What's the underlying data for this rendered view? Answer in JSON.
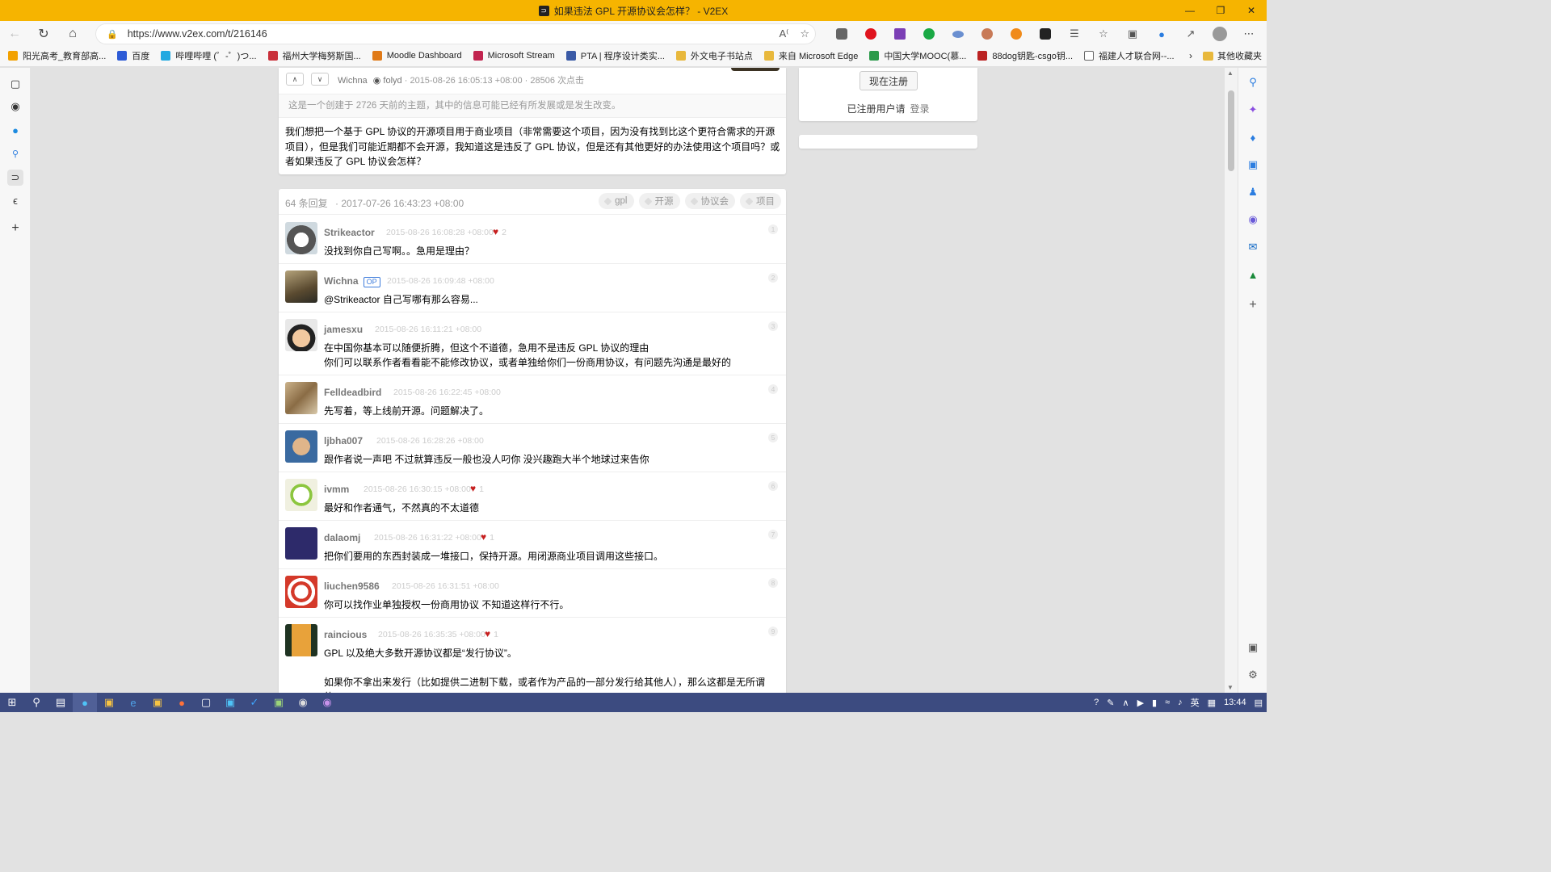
{
  "window": {
    "title": "如果违法 GPL 开源协议会怎样？ - V2EX"
  },
  "toolbar": {
    "url": "https://www.v2ex.com/t/216146"
  },
  "bookmarks": [
    {
      "label": "阳光高考_教育部高...",
      "color": "#f2a100"
    },
    {
      "label": "百度",
      "color": "#2d5bd6"
    },
    {
      "label": "哔哩哔哩 (゜-゜)つ...",
      "color": "#22a9e1"
    },
    {
      "label": "福州大学梅努斯国...",
      "color": "#c9303a"
    },
    {
      "label": "Moodle Dashboard",
      "color": "#e07a17"
    },
    {
      "label": "Microsoft Stream",
      "color": "#c1244f"
    },
    {
      "label": "PTA | 程序设计类实...",
      "color": "#3a5aa6"
    },
    {
      "label": "外文电子书站点",
      "color": "#e8b83c"
    },
    {
      "label": "来自 Microsoft Edge",
      "color": "#e8b83c"
    },
    {
      "label": "中国大学MOOC(慕...",
      "color": "#2b9a4a"
    },
    {
      "label": "88dog钥匙-csgo钥...",
      "color": "#b22"
    },
    {
      "label": "福建人才联合网--...",
      "color": "#ffffff"
    }
  ],
  "bookmarks_other": "其他收藏夹",
  "topic": {
    "author": "Wichna",
    "github": "folyd",
    "meta_rest": "· 2015-08-26 16:05:13 +08:00 · 28506 次点击",
    "notice": "这是一个创建于 2726 天前的主题，其中的信息可能已经有所发展或是发生改变。",
    "content": "我们想把一个基于 GPL 协议的开源项目用于商业项目（非常需要这个项目，因为没有找到比这个更符合需求的开源项目），但是我们可能近期都不会开源，我知道这是违反了 GPL 协议，但是还有其他更好的办法使用这个项目吗？或者如果违反了 GPL 协议会怎样？"
  },
  "sidebar": {
    "register_button": "现在注册",
    "registered_text": "已注册用户请",
    "login_link": "登录"
  },
  "replies_header": {
    "count_text": "64 条回复",
    "last_time": "·  2017-07-26 16:43:23 +08:00",
    "tags": [
      "gpl",
      "开源",
      "协议会",
      "项目"
    ]
  },
  "replies": [
    {
      "user": "Strikeactor",
      "time": "2015-08-26 16:08:28 +08:00",
      "likes": "2",
      "no": "1",
      "lines": [
        "没找到你自己写啊。。急用是理由？"
      ],
      "av": "husky"
    },
    {
      "user": "Wichna",
      "op": "OP",
      "time": "2015-08-26 16:09:48 +08:00",
      "likes": "",
      "no": "2",
      "lines": [
        "@Strikeactor 自己写哪有那么容易..."
      ],
      "av": "room"
    },
    {
      "user": "jamesxu",
      "time": "2015-08-26 16:11:21 +08:00",
      "likes": "",
      "no": "3",
      "lines": [
        "在中国你基本可以随便折腾，但这个不道德，急用不是违反 GPL 协议的理由",
        "你们可以联系作者看看能不能修改协议，或者单独给你们一份商用协议，有问题先沟通是最好的"
      ],
      "av": "cartoon"
    },
    {
      "user": "Felldeadbird",
      "time": "2015-08-26 16:22:45 +08:00",
      "likes": "",
      "no": "4",
      "lines": [
        "先写着，等上线前开源。问题解决了。"
      ],
      "av": "cat"
    },
    {
      "user": "ljbha007",
      "time": "2015-08-26 16:28:26 +08:00",
      "likes": "",
      "no": "5",
      "lines": [
        "跟作者说一声吧 不过就算违反一般也没人叼你 没兴趣跑大半个地球过来告你"
      ],
      "av": "face"
    },
    {
      "user": "ivmm",
      "time": "2015-08-26 16:30:15 +08:00",
      "likes": "1",
      "no": "6",
      "lines": [
        "最好和作者通气，不然真的不太道德"
      ],
      "av": "glasses"
    },
    {
      "user": "dalaomj",
      "time": "2015-08-26 16:31:22 +08:00",
      "likes": "1",
      "no": "7",
      "lines": [
        "把你们要用的东西封装成一堆接口，保持开源。用闭源商业项目调用这些接口。"
      ],
      "av": "invader"
    },
    {
      "user": "liuchen9586",
      "time": "2015-08-26 16:31:51 +08:00",
      "likes": "",
      "no": "8",
      "lines": [
        "你可以找作业单独授权一份商用协议 不知道这样行不行。"
      ],
      "av": "ring"
    },
    {
      "user": "raincious",
      "time": "2015-08-26 16:35:35 +08:00",
      "likes": "1",
      "no": "9",
      "lines": [
        "GPL 以及绝大多数开源协议都是“发行协议”。",
        "",
        "如果你不拿出来发行（比如提供二进制下载，或者作为产品的一部分发行给其他人），那么这都是无所谓的。"
      ],
      "av": "pixel"
    }
  ],
  "taskbar": {
    "time": "13:44",
    "ime": "英"
  },
  "colors": {
    "titlebar": "#f6b400",
    "taskbar": "#3c4b80",
    "heart": "#c61f1f",
    "op": "#3e7cdb"
  }
}
